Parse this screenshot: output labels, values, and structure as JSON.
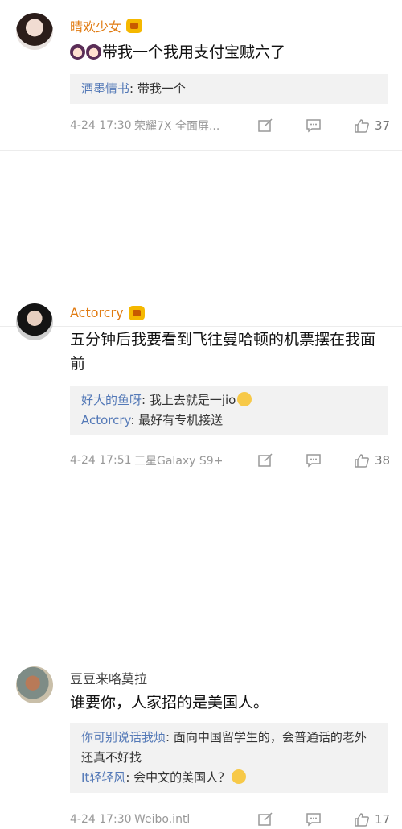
{
  "comments": [
    {
      "user": "晴欢少女",
      "text": "带我一个我用支付宝贼六了",
      "replies": [
        {
          "user": "酒墨情书",
          "text": ": 带我一个"
        }
      ],
      "time": "4-24 17:30",
      "device": "荣耀7X 全面屏...",
      "likes": "37"
    },
    {
      "user": "Actorcry",
      "text": "五分钟后我要看到飞往曼哈顿的机票摆在我面前",
      "replies": [
        {
          "user": "好大的鱼呀",
          "text": ": 我上去就是一jio"
        },
        {
          "user": "Actorcry",
          "text": ": 最好有专机接送"
        }
      ],
      "time": "4-24 17:51",
      "device": "三星Galaxy S9+",
      "likes": "38"
    },
    {
      "user": "豆豆来咯莫拉",
      "text": "谁要你，人家招的是美国人。",
      "replies": [
        {
          "user": "你可别说话我烦",
          "text": ": 面向中国留学生的，会普通话的老外还真不好找"
        },
        {
          "user": "It轻轻风",
          "text": ": 会中文的美国人？"
        }
      ],
      "time": "4-24 17:30",
      "device": "Weibo.intl",
      "likes": "17"
    }
  ],
  "icons": {
    "vip": "vip-crown-icon",
    "edit": "share-icon",
    "comment": "comment-icon",
    "like": "like-thumb-icon"
  },
  "colors": {
    "vip_name": "#e07a10",
    "reply_user": "#5479b7",
    "meta": "#999999"
  }
}
